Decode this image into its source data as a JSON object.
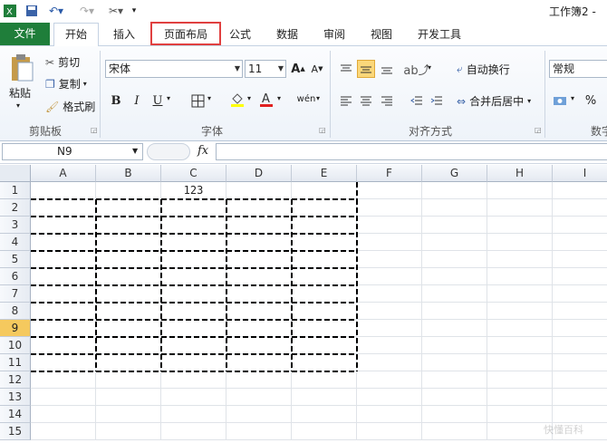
{
  "app": {
    "title": "工作簿2 - "
  },
  "tabs": [
    "文件",
    "开始",
    "插入",
    "页面布局",
    "公式",
    "数据",
    "审阅",
    "视图",
    "开发工具"
  ],
  "clipboard": {
    "paste": "粘贴",
    "cut": "剪切",
    "copy": "复制",
    "format_painter": "格式刷",
    "group": "剪贴板"
  },
  "font": {
    "name": "宋体",
    "size": "11",
    "group": "字体",
    "bold": "B",
    "italic": "I",
    "underline": "U"
  },
  "alignment": {
    "wrap": "自动换行",
    "merge": "合并后居中",
    "group": "对齐方式"
  },
  "number": {
    "format": "常规",
    "group": "数字",
    "percent": "%"
  },
  "formula_bar": {
    "name_box": "N9",
    "fx": "fx"
  },
  "grid": {
    "columns": [
      "A",
      "B",
      "C",
      "D",
      "E",
      "F",
      "G",
      "H",
      "I"
    ],
    "rows": [
      "1",
      "2",
      "3",
      "4",
      "5",
      "6",
      "7",
      "8",
      "9",
      "10",
      "11",
      "12",
      "13",
      "14",
      "15"
    ],
    "selected_row": "9",
    "cells": {
      "C1": "123"
    }
  },
  "watermark": "快懂百科"
}
